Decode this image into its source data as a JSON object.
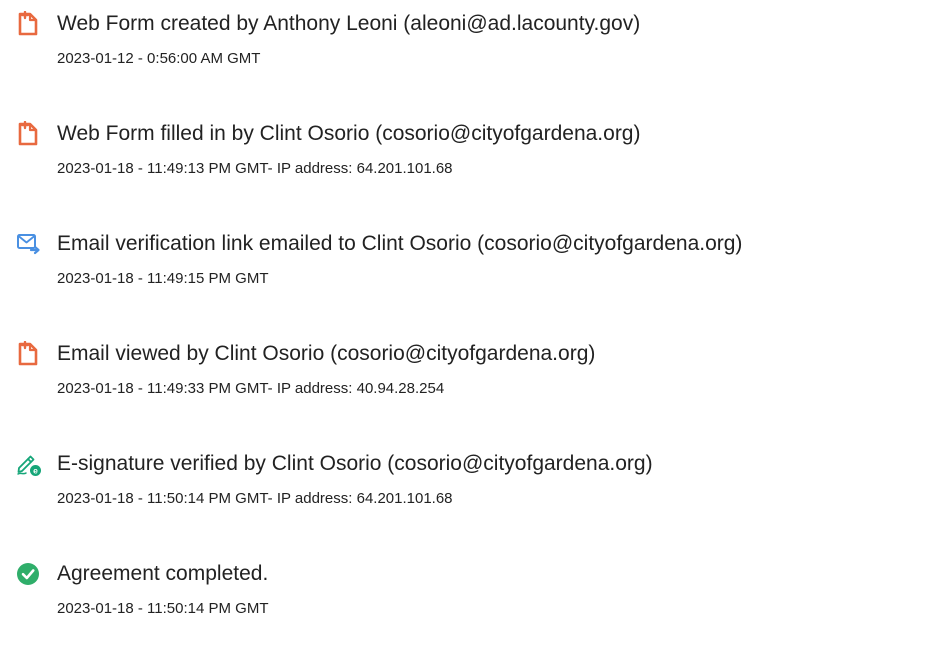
{
  "events": [
    {
      "icon": "document-form-icon",
      "title": "Web Form created by Anthony Leoni (aleoni@ad.lacounty.gov)",
      "timestamp": "2023-01-12 - 0:56:00 AM GMT"
    },
    {
      "icon": "document-form-icon",
      "title": "Web Form filled in by Clint Osorio (cosorio@cityofgardena.org)",
      "timestamp": "2023-01-18 - 11:49:13 PM GMT- IP address: 64.201.101.68"
    },
    {
      "icon": "email-send-icon",
      "title": "Email verification link emailed to Clint Osorio (cosorio@cityofgardena.org)",
      "timestamp": "2023-01-18 - 11:49:15 PM GMT"
    },
    {
      "icon": "document-form-icon",
      "title": "Email viewed by Clint Osorio (cosorio@cityofgardena.org)",
      "timestamp": "2023-01-18 - 11:49:33 PM GMT- IP address: 40.94.28.254"
    },
    {
      "icon": "esignature-pen-icon",
      "title": "E-signature verified by Clint Osorio (cosorio@cityofgardena.org)",
      "timestamp": "2023-01-18 - 11:50:14 PM GMT- IP address: 64.201.101.68"
    },
    {
      "icon": "checkmark-circle-icon",
      "title": "Agreement completed.",
      "timestamp": "2023-01-18 - 11:50:14 PM GMT"
    }
  ],
  "colors": {
    "document_icon": "#e8693f",
    "email_icon": "#4a90e2",
    "esign_icon": "#16a679",
    "check_icon": "#2fae6a",
    "text": "#222222"
  }
}
